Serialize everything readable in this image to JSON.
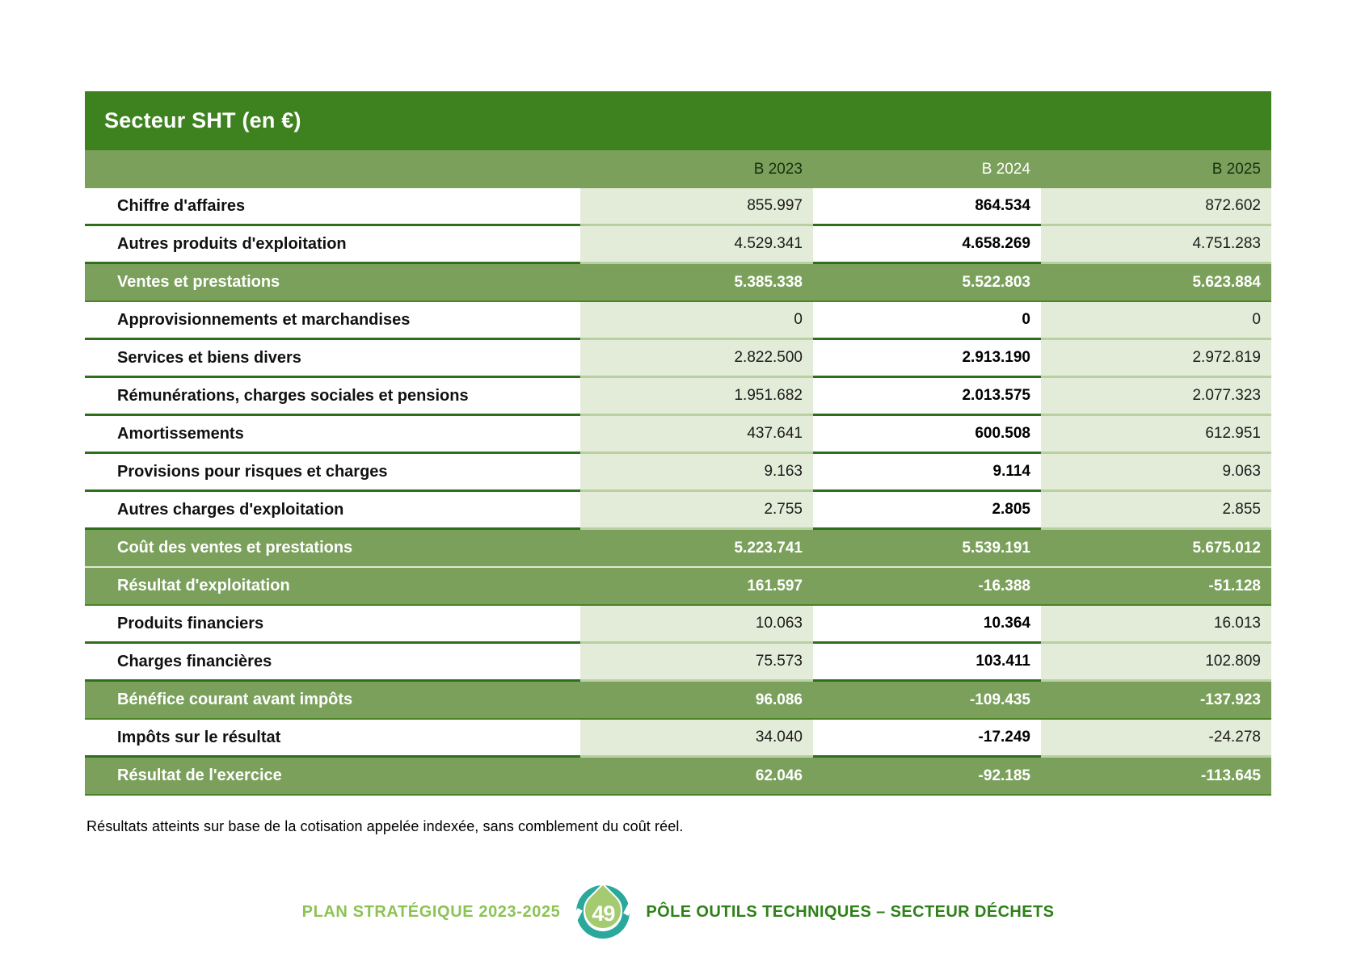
{
  "table": {
    "title": "Secteur SHT (en €)",
    "columns": [
      "B 2023",
      "B 2024",
      "B 2025"
    ],
    "rows": [
      {
        "label": "Chiffre d'affaires",
        "values": [
          "855.997",
          "864.534",
          "872.602"
        ],
        "highlight": false
      },
      {
        "label": "Autres produits d'exploitation",
        "values": [
          "4.529.341",
          "4.658.269",
          "4.751.283"
        ],
        "highlight": false
      },
      {
        "label": "Ventes et prestations",
        "values": [
          "5.385.338",
          "5.522.803",
          "5.623.884"
        ],
        "highlight": true
      },
      {
        "label": "Approvisionnements et marchandises",
        "values": [
          "0",
          "0",
          "0"
        ],
        "highlight": false
      },
      {
        "label": "Services et biens divers",
        "values": [
          "2.822.500",
          "2.913.190",
          "2.972.819"
        ],
        "highlight": false
      },
      {
        "label": "Rémunérations, charges sociales et pensions",
        "values": [
          "1.951.682",
          "2.013.575",
          "2.077.323"
        ],
        "highlight": false
      },
      {
        "label": "Amortissements",
        "values": [
          "437.641",
          "600.508",
          "612.951"
        ],
        "highlight": false
      },
      {
        "label": "Provisions pour risques et charges",
        "values": [
          "9.163",
          "9.114",
          "9.063"
        ],
        "highlight": false
      },
      {
        "label": "Autres charges d'exploitation",
        "values": [
          "2.755",
          "2.805",
          "2.855"
        ],
        "highlight": false
      },
      {
        "label": "Coût des ventes et prestations",
        "values": [
          "5.223.741",
          "5.539.191",
          "5.675.012"
        ],
        "highlight": true
      },
      {
        "label": "Résultat d'exploitation",
        "values": [
          "161.597",
          "-16.388",
          "-51.128"
        ],
        "highlight": true
      },
      {
        "label": "Produits financiers",
        "values": [
          "10.063",
          "10.364",
          "16.013"
        ],
        "highlight": false
      },
      {
        "label": "Charges financières",
        "values": [
          "75.573",
          "103.411",
          "102.809"
        ],
        "highlight": false
      },
      {
        "label": "Bénéfice courant avant impôts",
        "values": [
          "96.086",
          "-109.435",
          "-137.923"
        ],
        "highlight": true
      },
      {
        "label": "Impôts sur le résultat",
        "values": [
          "34.040",
          "-17.249",
          "-24.278"
        ],
        "highlight": false
      },
      {
        "label": "Résultat de l'exercice",
        "values": [
          "62.046",
          "-92.185",
          "-113.645"
        ],
        "highlight": true
      }
    ]
  },
  "footnote": "Résultats atteints sur base de la cotisation appelée indexée, sans comblement du coût réel.",
  "footer": {
    "left": "PLAN STRATÉGIQUE 2023-2025",
    "page_number": "49",
    "right": "PÔLE OUTILS TECHNIQUES – SECTEUR DÉCHETS"
  },
  "colors": {
    "dark_green": "#3d821e",
    "medium_green": "#7ba05c",
    "light_green_cell": "#e3ebd9",
    "row_line_dark": "#2e6f1b",
    "row_line_light": "#b9d0a3",
    "badge_teal": "#2aa89b",
    "badge_drop_green": "#a5cb70",
    "footer_left_green": "#8cc355",
    "footer_right_green": "#2e8118"
  }
}
